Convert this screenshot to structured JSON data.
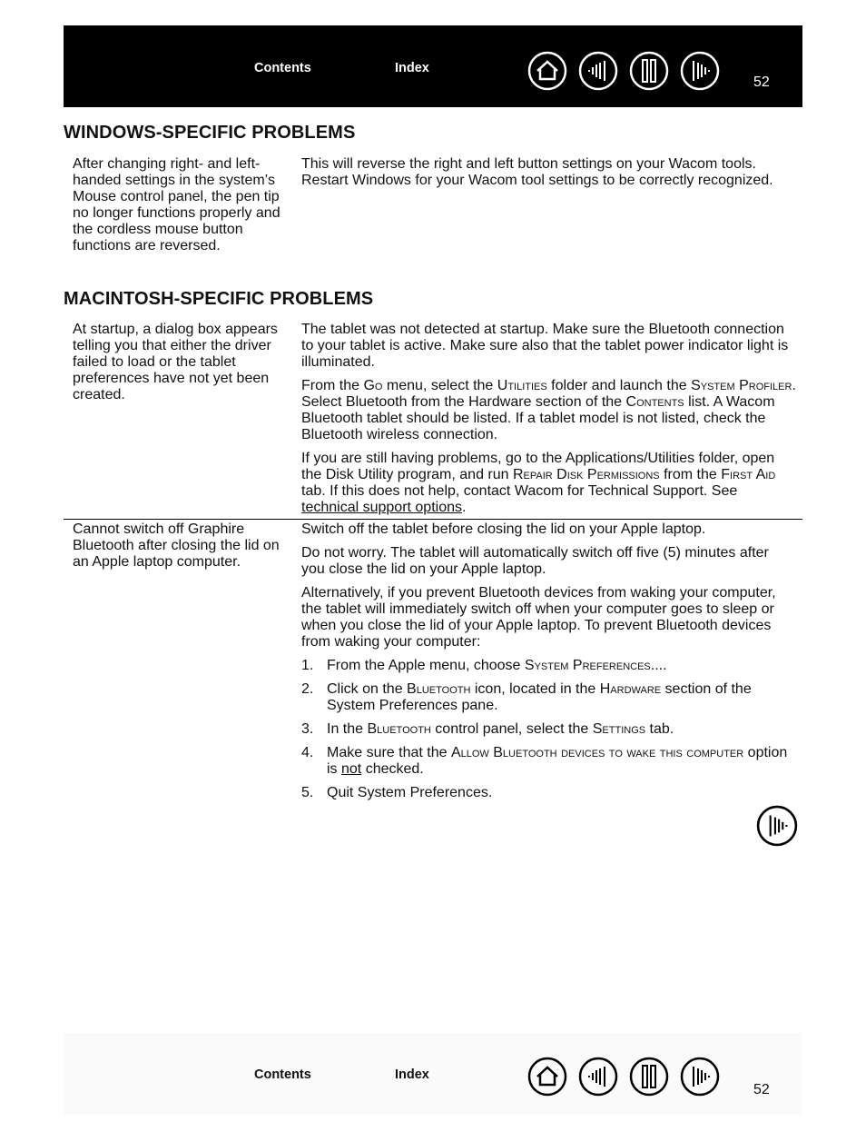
{
  "header": {
    "contents_label": "Contents",
    "index_label": "Index",
    "page_number": "52",
    "nav_icons": [
      "home-icon",
      "previous-page-icon",
      "contents-pages-icon",
      "next-page-icon"
    ]
  },
  "sections": [
    {
      "title": "WINDOWS-SPECIFIC PROBLEMS",
      "rows": [
        {
          "problem": "After changing right- and left-handed settings in the system’s Mouse control panel, the pen tip no longer functions properly and the cordless mouse button functions are reversed.",
          "solution": "This will reverse the right and left button settings on your Wacom tools. Restart Windows for your Wacom tool settings to be correctly recognized."
        }
      ]
    },
    {
      "title": "MACINTOSH-SPECIFIC PROBLEMS",
      "rows": [
        {
          "problem": "At startup, a dialog box appears telling you that either the driver failed to load or the tablet preferences have not yet been created.",
          "solution_p1": "The tablet was not detected at startup.  Make sure the Bluetooth connection to your tablet is active.  Make sure also that the tablet power indicator light is illuminated.",
          "solution_p2": {
            "t1": "From the ",
            "go": "Go",
            "t2": " menu, select the ",
            "utilities": "Utilities",
            "t3": " folder and launch the ",
            "system_profiler": "System Profiler",
            "t4": ".  Select Bluetooth from the Hardware section of the ",
            "contents": "Contents",
            "t5": " list.  A Wacom Bluetooth tablet should be listed.  If a tablet model is not listed, check the Bluetooth wireless connection."
          },
          "solution_p3": {
            "t1": "If you are still having problems, go to the Applications/Utilities folder, open the Disk Utility program, and run ",
            "repair": "Repair Disk Permissions",
            "t2": " from the ",
            "first_aid": "First Aid",
            "t3": " tab.  If this does not help, contact Wacom for Technical Support.  See ",
            "link": "technical support options",
            "t4": "."
          }
        },
        {
          "problem": "Cannot switch off Graphire Bluetooth after closing the lid on an Apple laptop computer.",
          "solution_p1": "Switch off the tablet before closing the lid on your Apple laptop.",
          "solution_p2": "Do not worry.  The tablet will automatically switch off five (5) minutes after you close the lid on your Apple laptop.",
          "solution_p3": "Alternatively, if you prevent Bluetooth devices from waking your computer, the tablet will immediately switch off when your computer goes to sleep or when you close the lid of your Apple laptop.  To prevent Bluetooth devices from waking your computer:",
          "steps": [
            {
              "num": "1.",
              "t1": "From the Apple menu, choose ",
              "sc1": "System Preferences....",
              "t2": ""
            },
            {
              "num": "2.",
              "t1": "Click on the ",
              "sc1": "Bluetooth",
              "t2": " icon, located in the ",
              "sc2": "Hardware",
              "t3": " section of the System Preferences pane."
            },
            {
              "num": "3.",
              "t1": "In the ",
              "sc1": "Bluetooth",
              "t2": " control panel, select the ",
              "sc2": "Settings",
              "t3": " tab."
            },
            {
              "num": "4.",
              "t1": "Make sure that the ",
              "sc1": "Allow Bluetooth devices to wake this computer",
              "t2": " option is ",
              "u": "not",
              "t3": " checked."
            },
            {
              "num": "5.",
              "t1": "Quit System Preferences."
            }
          ]
        }
      ]
    }
  ],
  "footer": {
    "contents_label": "Contents",
    "index_label": "Index",
    "page_number": "52"
  }
}
